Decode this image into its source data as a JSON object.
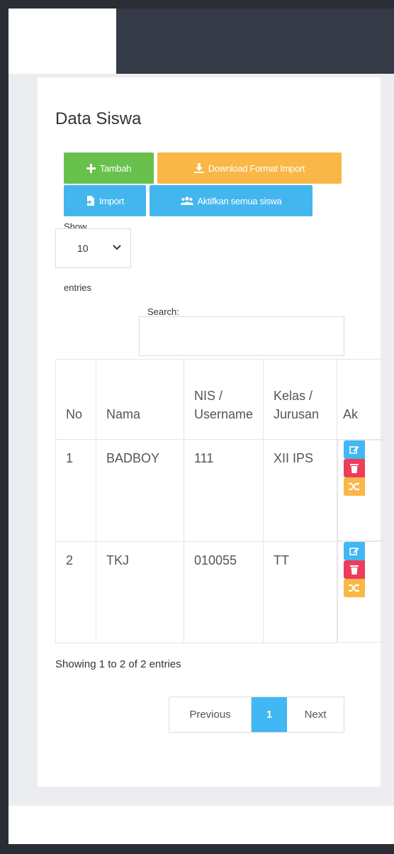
{
  "page_title": "Data Siswa",
  "buttons": {
    "add": "Tambah",
    "download": "Download Format Import",
    "import": "Import",
    "activate_all": "Aktifkan semua siswa"
  },
  "length_menu": {
    "show": "Show",
    "value": "10",
    "entries": "entries"
  },
  "search": {
    "label": "Search:",
    "value": ""
  },
  "table": {
    "headers": [
      "No",
      "Nama",
      "NIS /\nUsername",
      "Kelas /\nJurusan",
      "Ak"
    ],
    "rows": [
      {
        "no": "1",
        "nama": "BADBOY",
        "nis": "111",
        "kelas": "XII IPS"
      },
      {
        "no": "2",
        "nama": "TKJ",
        "nis": "010055",
        "kelas": "TT"
      }
    ]
  },
  "info": "Showing 1 to 2 of 2 entries",
  "pagination": {
    "previous": "Previous",
    "current": "1",
    "next": "Next"
  },
  "colors": {
    "green": "#68c14c",
    "orange": "#f9b747",
    "blue": "#44b6ee",
    "red": "#ee3c5a",
    "dark": "#343a46"
  },
  "icons": [
    "plus-icon",
    "download-icon",
    "import-icon",
    "users-icon",
    "edit-icon",
    "trash-icon",
    "shuffle-icon",
    "chevron-down-icon"
  ]
}
